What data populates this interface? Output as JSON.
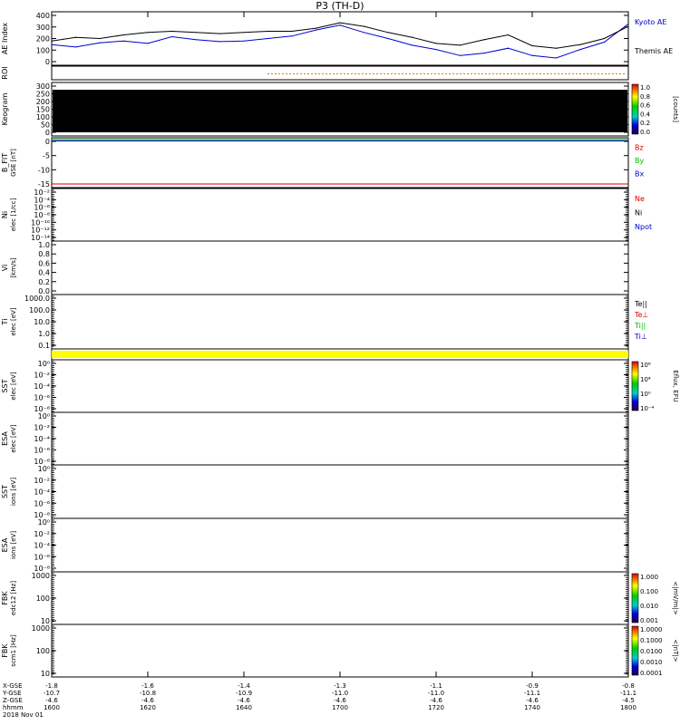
{
  "title": "P3 (TH-D)",
  "colors": {
    "kyoto": "#0000cc",
    "themis": "#000000",
    "red": "#dd0000",
    "green": "#00bb00",
    "blue": "#0000cc",
    "yellow": "#ffff00",
    "roi": "#cc8800"
  },
  "panels": [
    {
      "id": "ae",
      "label": "AE Index",
      "unit": "",
      "ticks": [
        "400",
        "300",
        "200",
        "100",
        "0"
      ],
      "legend": [
        {
          "text": "Kyoto AE",
          "color": "#0000cc"
        },
        {
          "text": "Themis AE",
          "color": "#000000"
        }
      ]
    },
    {
      "id": "roi",
      "label": "ROI",
      "unit": "",
      "ticks": [],
      "legend": []
    },
    {
      "id": "keogram",
      "label": "Keogram",
      "unit": "",
      "ticks": [
        "300",
        "250",
        "200",
        "150",
        "100",
        "50",
        "0"
      ],
      "colorbar": {
        "ticks": [
          "1.0",
          "0.8",
          "0.6",
          "0.4",
          "0.2",
          "0.0"
        ],
        "label": "[counts]"
      },
      "legend": []
    },
    {
      "id": "bfit",
      "label": "B_FIT",
      "unit": "GSE [nT]",
      "ticks": [
        "0",
        "-5",
        "-10",
        "-15"
      ],
      "legend": [
        {
          "text": "Bz",
          "color": "#dd0000"
        },
        {
          "text": "By",
          "color": "#00bb00"
        },
        {
          "text": "Bx",
          "color": "#0000cc"
        }
      ]
    },
    {
      "id": "ni",
      "label": "Ni",
      "unit": "elec [1/cc]",
      "ticks": [
        "10⁻²",
        "10⁻⁴",
        "10⁻⁶",
        "10⁻⁸",
        "10⁻¹⁰",
        "10⁻¹²",
        "10⁻¹⁴"
      ],
      "legend": [
        {
          "text": "Ne",
          "color": "#dd0000"
        },
        {
          "text": "Ni",
          "color": "#000000"
        },
        {
          "text": "Npot",
          "color": "#0000cc"
        }
      ]
    },
    {
      "id": "vi",
      "label": "Vi",
      "unit": "[km/s]",
      "ticks": [
        "1.0",
        "0.8",
        "0.6",
        "0.4",
        "0.2",
        "0.0"
      ],
      "legend": []
    },
    {
      "id": "ti",
      "label": "Ti",
      "unit": "elec [eV]",
      "ticks": [
        "1000.0",
        "100.0",
        "10.0",
        "1.0",
        "0.1"
      ],
      "legend": [
        {
          "text": "Te||",
          "color": "#000000"
        },
        {
          "text": "Te⊥",
          "color": "#dd0000"
        },
        {
          "text": "Ti||",
          "color": "#00bb00"
        },
        {
          "text": "Ti⊥",
          "color": "#0000cc"
        }
      ]
    },
    {
      "id": "sst1",
      "label": "SST",
      "unit": "elec [eV]",
      "ticks": [
        "10⁰",
        "10⁻²",
        "10⁻⁴",
        "10⁻⁶",
        "10⁻⁸"
      ],
      "colorbar": {
        "ticks": [
          "10⁸",
          "10⁴",
          "10⁰",
          "10⁻⁴"
        ],
        "label": "Eflux, EFU"
      },
      "legend": []
    },
    {
      "id": "esa1",
      "label": "ESA",
      "unit": "elec [eV]",
      "ticks": [
        "10⁰",
        "10⁻²",
        "10⁻⁴",
        "10⁻⁶",
        "10⁻⁸"
      ],
      "legend": []
    },
    {
      "id": "sst2",
      "label": "SST",
      "unit": "ions [eV]",
      "ticks": [
        "10⁰",
        "10⁻²",
        "10⁻⁴",
        "10⁻⁶",
        "10⁻⁸"
      ],
      "legend": []
    },
    {
      "id": "esa2",
      "label": "ESA",
      "unit": "ions [eV]",
      "ticks": [
        "10⁰",
        "10⁻²",
        "10⁻⁴",
        "10⁻⁶",
        "10⁻⁸"
      ],
      "legend": []
    },
    {
      "id": "fbk1",
      "label": "FBK",
      "unit": "edc12 [Hz]",
      "ticks": [
        "1000",
        "100",
        "10"
      ],
      "colorbar": {
        "ticks": [
          "1.000",
          "0.100",
          "0.010",
          "0.001"
        ],
        "label": "<|mV/m|>"
      },
      "legend": []
    },
    {
      "id": "fbk2",
      "label": "FBK",
      "unit": "scm1 [Hz]",
      "ticks": [
        "1000",
        "100",
        "10"
      ],
      "colorbar": {
        "ticks": [
          "1.0000",
          "0.1000",
          "0.0100",
          "0.0010",
          "0.0001"
        ],
        "label": "<|nT|>"
      },
      "legend": []
    }
  ],
  "xaxis": {
    "row_labels": [
      "X-GSE",
      "Y-GSE",
      "Z-GSE",
      "hhmm",
      "2018 Nov 01"
    ],
    "x_gse": [
      "-1.8",
      "-1.6",
      "-1.4",
      "-1.3",
      "-1.1",
      "-0.9",
      "-0.8"
    ],
    "y_gse": [
      "-10.7",
      "-10.8",
      "-10.9",
      "-11.0",
      "-11.0",
      "-11.1",
      "-11.1"
    ],
    "z_gse": [
      "-4.6",
      "-4.6",
      "-4.6",
      "-4.6",
      "-4.6",
      "-4.6",
      "-4.5"
    ],
    "hhmm": [
      "1600",
      "1620",
      "1640",
      "1700",
      "1720",
      "1740",
      "1800"
    ]
  },
  "chart_data": {
    "type": "line",
    "title": "P3 (TH-D)",
    "xlabel": "hhmm",
    "ylabel": "AE Index",
    "xlim": [
      0,
      120
    ],
    "ylim": [
      -20,
      420
    ],
    "x_note_unit": "minutes after 1600 UT",
    "series": [
      {
        "name": "Kyoto AE",
        "color": "#0000cc",
        "x": [
          0,
          5,
          10,
          15,
          20,
          25,
          30,
          35,
          40,
          45,
          50,
          55,
          60,
          65,
          70,
          75,
          80,
          85,
          90,
          95,
          100,
          105,
          110,
          115,
          120
        ],
        "y": [
          150,
          130,
          165,
          180,
          160,
          215,
          190,
          175,
          180,
          200,
          220,
          270,
          310,
          250,
          200,
          145,
          110,
          60,
          80,
          120,
          60,
          40,
          110,
          170,
          320
        ]
      },
      {
        "name": "Themis AE",
        "color": "#000000",
        "x": [
          0,
          5,
          10,
          15,
          20,
          25,
          30,
          35,
          40,
          45,
          50,
          55,
          60,
          65,
          70,
          75,
          80,
          85,
          90,
          95,
          100,
          105,
          110,
          115,
          120
        ],
        "y": [
          180,
          210,
          200,
          230,
          250,
          260,
          250,
          240,
          250,
          260,
          260,
          285,
          330,
          300,
          250,
          210,
          160,
          145,
          190,
          230,
          140,
          120,
          150,
          200,
          300
        ]
      }
    ]
  }
}
